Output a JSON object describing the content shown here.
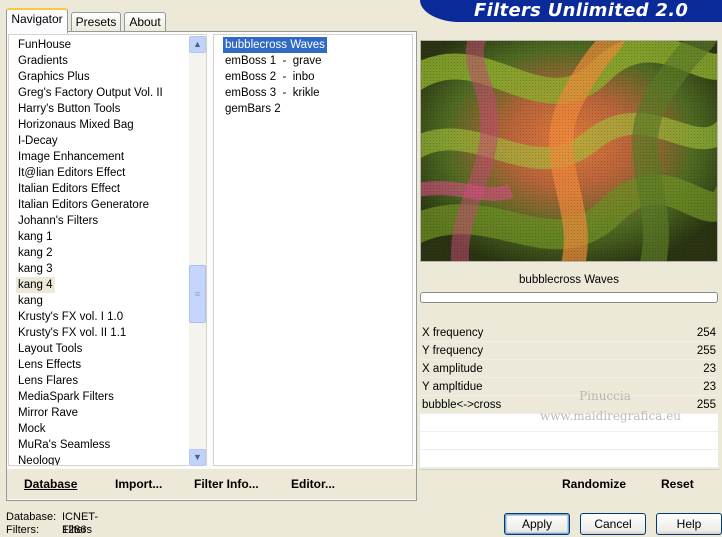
{
  "banner": {
    "title": "Filters Unlimited 2.0"
  },
  "tabs": [
    {
      "label": "Navigator",
      "active": true
    },
    {
      "label": "Presets",
      "active": false
    },
    {
      "label": "About",
      "active": false
    }
  ],
  "categories": {
    "items": [
      "FunHouse",
      "Gradients",
      "Graphics Plus",
      "Greg's Factory Output Vol. II",
      "Harry's Button Tools",
      "Horizonaus Mixed Bag",
      "I-Decay",
      "Image Enhancement",
      "It@lian Editors Effect",
      "Italian Editors Effect",
      "Italian Editors Generatore",
      "Johann's Filters",
      "kang 1",
      "kang 2",
      "kang 3",
      "kang 4",
      "kang",
      "Krusty's FX vol. I 1.0",
      "Krusty's FX vol. II 1.1",
      "Layout Tools",
      "Lens Effects",
      "Lens Flares",
      "MediaSpark Filters",
      "Mirror Rave",
      "Mock",
      "MuRa's Seamless",
      "Neology"
    ],
    "selected": "kang 4"
  },
  "filters": {
    "items": [
      "bubblecross Waves",
      "emBoss 1  -  grave",
      "emBoss 2  -  inbo",
      "emBoss 3  -  krikle",
      "gemBars 2"
    ],
    "selected": "bubblecross Waves"
  },
  "left_buttons": {
    "database_label": "Database",
    "import_label": "Import...",
    "filter_info_label": "Filter Info...",
    "editor_label": "Editor..."
  },
  "preview": {
    "filter_name": "bubblecross Waves"
  },
  "params": [
    {
      "label": "X frequency",
      "value": "254"
    },
    {
      "label": "Y frequency",
      "value": "255"
    },
    {
      "label": "X amplitude",
      "value": "23"
    },
    {
      "label": "Y ampltidue",
      "value": "23"
    },
    {
      "label": "bubble<->cross",
      "value": "255"
    }
  ],
  "watermark": {
    "line1": "Pinuccia",
    "line2": "www.maidiregrafica.eu"
  },
  "right_buttons": {
    "randomize_label": "Randomize",
    "reset_label": "Reset"
  },
  "status": {
    "database_label": "Database:",
    "database_value": "ICNET-Filters",
    "filters_label": "Filters:",
    "filters_value": "1286"
  },
  "dialog_buttons": {
    "apply_label": "Apply",
    "cancel_label": "Cancel",
    "help_label": "Help"
  },
  "colors": {
    "banner": "#0a2a9a",
    "selection": "#316ac5",
    "panel": "#ece9d8"
  },
  "icons": {
    "scroll_up": "chevron-up-icon",
    "scroll_down": "chevron-down-icon",
    "thumb_grip": "grip-icon"
  }
}
